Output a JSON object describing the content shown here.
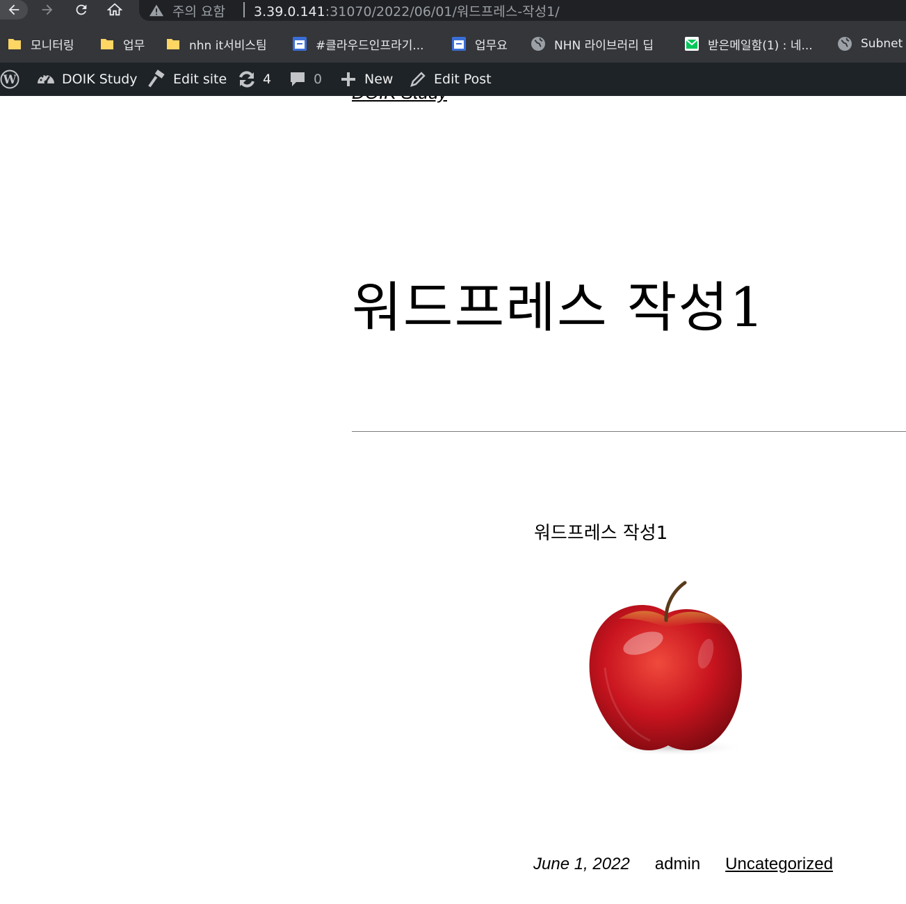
{
  "browser": {
    "security_warning": "주의 요함",
    "url_host": "3.39.0.141",
    "url_path": ":31070/2022/06/01/워드프레스-작성1/"
  },
  "bookmarks": [
    {
      "label": "모니터링",
      "icon": "folder-icon"
    },
    {
      "label": "업무",
      "icon": "folder-icon"
    },
    {
      "label": "nhn it서비스팀",
      "icon": "folder-icon"
    },
    {
      "label": "#클라우드인프라기...",
      "icon": "calendar-icon"
    },
    {
      "label": "업무요",
      "icon": "calendar-icon"
    },
    {
      "label": "NHN 라이브러리 딥",
      "icon": "globe-icon"
    },
    {
      "label": "받은메일함(1) : 네...",
      "icon": "mail-icon"
    },
    {
      "label": "Subnet",
      "icon": "globe-icon"
    }
  ],
  "admin_bar": {
    "site_name": "DOIK Study",
    "edit_site": "Edit site",
    "updates_count": "4",
    "comments_count": "0",
    "new_label": "New",
    "edit_post": "Edit Post"
  },
  "page": {
    "site_title": "DOIK Study",
    "post_title": "워드프레스 작성1",
    "content_text": "워드프레스 작성1",
    "image": "red-apple-photo",
    "meta": {
      "date": "June 1, 2022",
      "author": "admin",
      "category": "Uncategorized"
    }
  },
  "colors": {
    "browser_chrome": "#35363a",
    "omnibox": "#202124",
    "admin_bar": "#1d2327",
    "page_bg": "#ffffff"
  }
}
